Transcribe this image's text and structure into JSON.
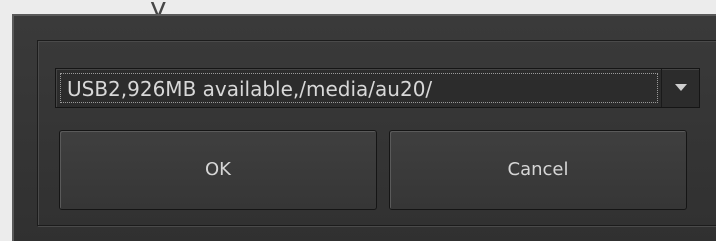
{
  "background_text": "y",
  "dialog": {
    "device_select": {
      "value": "USB2,926MB available,/media/au20/"
    },
    "buttons": {
      "ok_label": "OK",
      "cancel_label": "Cancel"
    }
  },
  "colors": {
    "dialog_bg": "#363636",
    "text": "#d6d6d6",
    "border_dark": "#151515"
  },
  "icons": {
    "dropdown": "chevron-down-icon"
  }
}
